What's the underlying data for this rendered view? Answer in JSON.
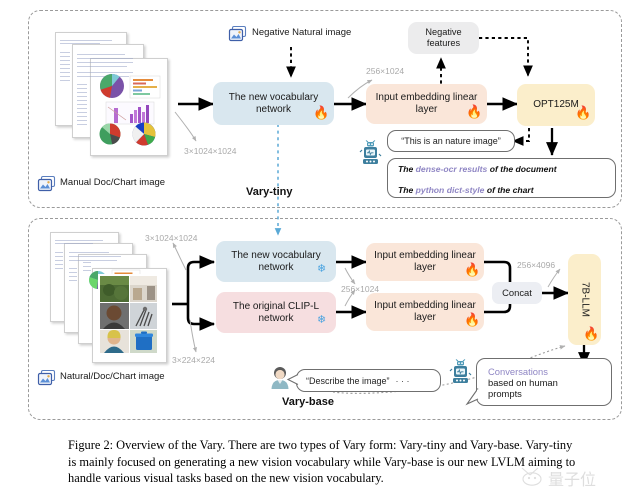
{
  "figure": {
    "caption": "Figure 2: Overview of the Vary. There are two types of Vary form: Vary-tiny and Vary-base. Vary-tiny is mainly focused on generating a new vision vocabulary while Vary-base is our new LVLM aiming to handle various visual tasks based on the new vision vocabulary.",
    "watermark": "量子位"
  },
  "vary_tiny": {
    "section_label": "Vary-tiny",
    "input_caption": "Manual Doc/Chart image",
    "input_dim": "3×1024×1024",
    "negative_input": "Negative Natural image",
    "vocab_box": "The new vocabulary network",
    "embed_dim": "256×1024",
    "embed_box": "Input embedding linear layer",
    "negative_features": "Negative features",
    "llm_box": "OPT125M",
    "nature_quote": "“This is an nature image”",
    "output_line1_a": "The ",
    "output_line1_b": "dense-ocr results",
    "output_line1_c": " of the document",
    "output_line2_a": "The ",
    "output_line2_b": "python dict-style",
    "output_line2_c": " of the chart"
  },
  "vary_base": {
    "section_label": "Vary-base",
    "input_caption": "Natural/Doc/Chart image",
    "input_dim_top": "3×1024×1024",
    "input_dim_bottom": "3×224×224",
    "vocab_box": "The new vocabulary network",
    "clip_box": "The original CLIP-L network",
    "embed_box_top": "Input embedding linear layer",
    "embed_box_bottom": "Input embedding linear layer",
    "embed_dim": "256×1024",
    "concat": "Concat",
    "concat_dim": "256×4096",
    "llm_box": "7B-LLM",
    "prompt_quote": "“Describe the image”",
    "prompt_ellipsis": "· · ·",
    "output_highlight": "Conversations",
    "output_rest_line1": "based on human",
    "output_rest_line2": "prompts"
  },
  "icons": {
    "trainable": "flame-icon",
    "frozen": "snowflake-icon",
    "gallery": "image-gallery-icon",
    "robot": "robot-icon",
    "user": "user-avatar-icon"
  },
  "colors": {
    "vocab_blue": "#d9e7ef",
    "embed_peach": "#fae6d9",
    "llm_yellow": "#fbeecb",
    "clip_pink": "#f6dee0",
    "neg_grey": "#ececed",
    "concat_grey": "#eceef3",
    "flame": "#f08b33",
    "snow": "#4aa3e0",
    "dim_text": "#a9a9a9",
    "highlight_purple": "#8f86c4",
    "dashed_border": "#9a9a9a"
  }
}
